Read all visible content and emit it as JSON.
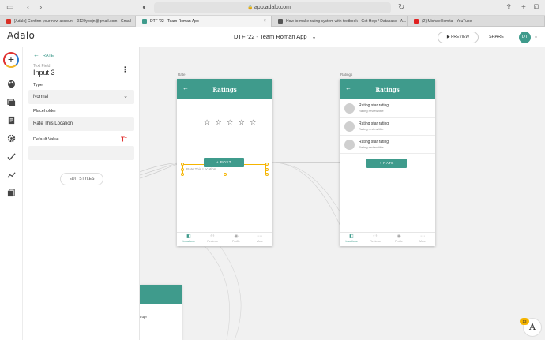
{
  "browser": {
    "url": "app.adalo.com",
    "tabs": [
      {
        "title": "[Adalo] Confirm your new account - 0120yoojn@gmail.com - Gmail",
        "color": "#d93025"
      },
      {
        "title": "DTF '22 - Team Roman App",
        "color": "#3f9b8c"
      },
      {
        "title": "How to make rating system with textbook - Get Help / Database - A...",
        "color": "#555555"
      },
      {
        "title": "(2) Michael Ismita - YouTube",
        "color": "#e02020"
      }
    ]
  },
  "header": {
    "logo": "Adalo",
    "app_title": "DTF '22 - Team Roman App",
    "preview_label": "PREVIEW",
    "share_label": "SHARE",
    "avatar_initials": "DT"
  },
  "panel": {
    "back_label": "RATE",
    "component_type": "Text Field",
    "component_name": "Input 3",
    "type_label": "Type",
    "type_value": "Normal",
    "placeholder_label": "Placeholder",
    "placeholder_value": "Rate This Location",
    "default_label": "Default Value",
    "default_value": "",
    "edit_styles_label": "EDIT STYLES"
  },
  "screen_rate": {
    "label": "Rate",
    "title": "Ratings",
    "stars": "☆ ☆ ☆ ☆ ☆",
    "input_placeholder": "Rate This Location",
    "post_label": "+  POST",
    "tabs": [
      "Locations",
      "Reviews",
      "Profile",
      "More"
    ]
  },
  "screen_ratings": {
    "label": "Ratings",
    "title": "Ratings",
    "rows": [
      {
        "title": "Rating star rating",
        "subtitle": "Rating review title"
      },
      {
        "title": "Rating star rating",
        "subtitle": "Rating review title"
      },
      {
        "title": "Rating star rating",
        "subtitle": "Rating review title"
      }
    ],
    "rate_label": "+  RATE",
    "tabs": [
      "Locations",
      "Reviews",
      "Profile",
      "More"
    ]
  },
  "third_screen": {
    "text": "t up!"
  },
  "help": {
    "count": "13",
    "glyph": "A"
  },
  "colors": {
    "accent": "#3f9b8c",
    "selection": "#f5b400"
  }
}
